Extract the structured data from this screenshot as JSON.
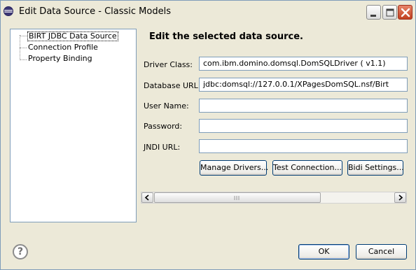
{
  "window": {
    "title": "Edit Data Source - Classic Models"
  },
  "tree": {
    "items": [
      {
        "label": "BIRT JDBC Data Source",
        "selected": true
      },
      {
        "label": "Connection Profile",
        "selected": false
      },
      {
        "label": "Property Binding",
        "selected": false
      }
    ]
  },
  "form": {
    "header": "Edit the selected data source.",
    "driver_class_label": "Driver Class:",
    "driver_class_value": "com.ibm.domino.domsql.DomSQLDriver ( v1.1)",
    "database_url_label": "Database URL:",
    "database_url_value": "jdbc:domsql://127.0.0.1/XPagesDomSQL.nsf/Birt",
    "user_name_label": "User Name:",
    "user_name_value": "",
    "password_label": "Password:",
    "password_value": "",
    "jndi_url_label": "JNDI URL:",
    "jndi_url_value": "",
    "manage_drivers_label": "Manage Drivers...",
    "test_connection_label": "Test Connection...",
    "bidi_settings_label": "Bidi Settings..."
  },
  "footer": {
    "help_symbol": "?",
    "ok_label": "OK",
    "cancel_label": "Cancel"
  },
  "icons": {
    "app": "eclipse-icon",
    "help": "help-icon",
    "minimize": "minimize-icon",
    "maximize": "maximize-icon",
    "close": "close-icon",
    "scroll_left": "arrow-left-icon",
    "scroll_right": "arrow-right-icon"
  },
  "colors": {
    "dialog_bg": "#ece9d8",
    "border": "#7f9db9",
    "close_button": "#c1401f"
  }
}
